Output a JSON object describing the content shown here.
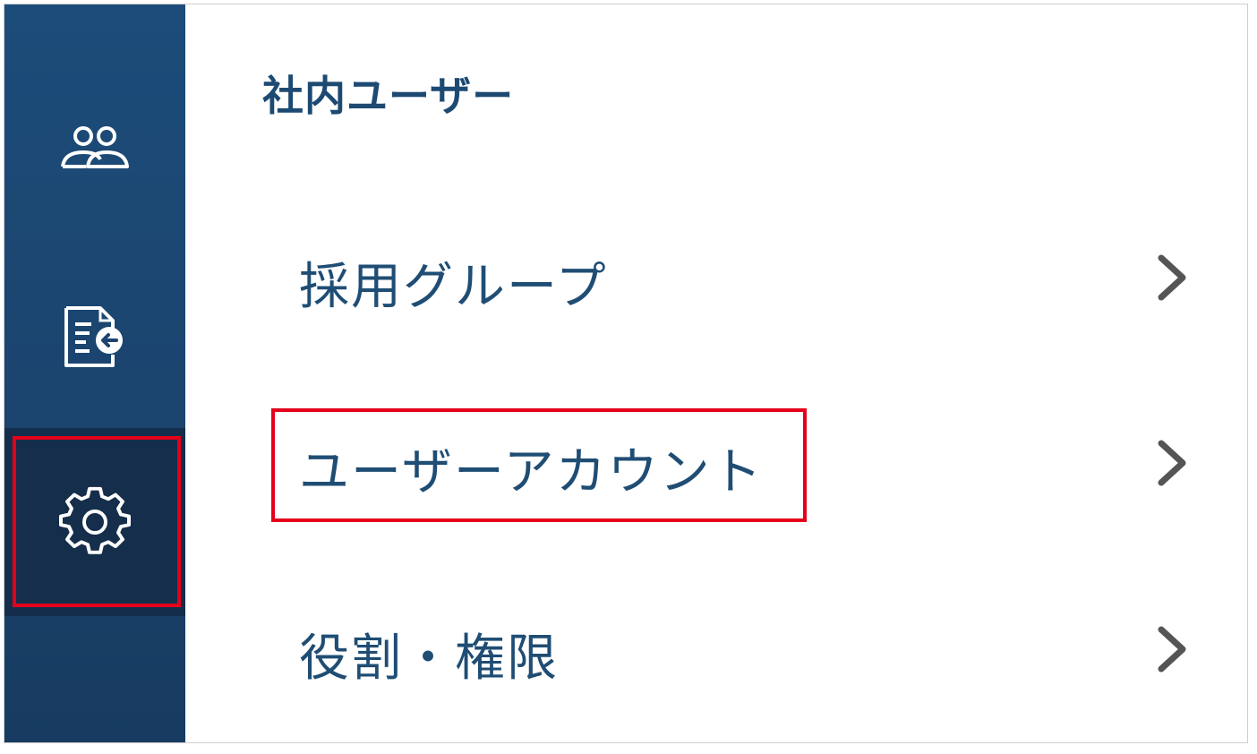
{
  "header": {
    "title": "社内ユーザー"
  },
  "sidebar": {
    "items": [
      {
        "icon": "users-icon",
        "active": false
      },
      {
        "icon": "document-import-icon",
        "active": false
      },
      {
        "icon": "gear-icon",
        "active": true
      }
    ]
  },
  "menu": {
    "items": [
      {
        "label": "採用グループ"
      },
      {
        "label": "ユーザーアカウント",
        "highlighted": true
      },
      {
        "label": "役割・権限"
      }
    ]
  },
  "colors": {
    "sidebar_bg": "#1b446e",
    "sidebar_active_bg": "#152e4c",
    "text_primary": "#1f4d74",
    "highlight_border": "#e5001b",
    "chevron": "#555555"
  }
}
